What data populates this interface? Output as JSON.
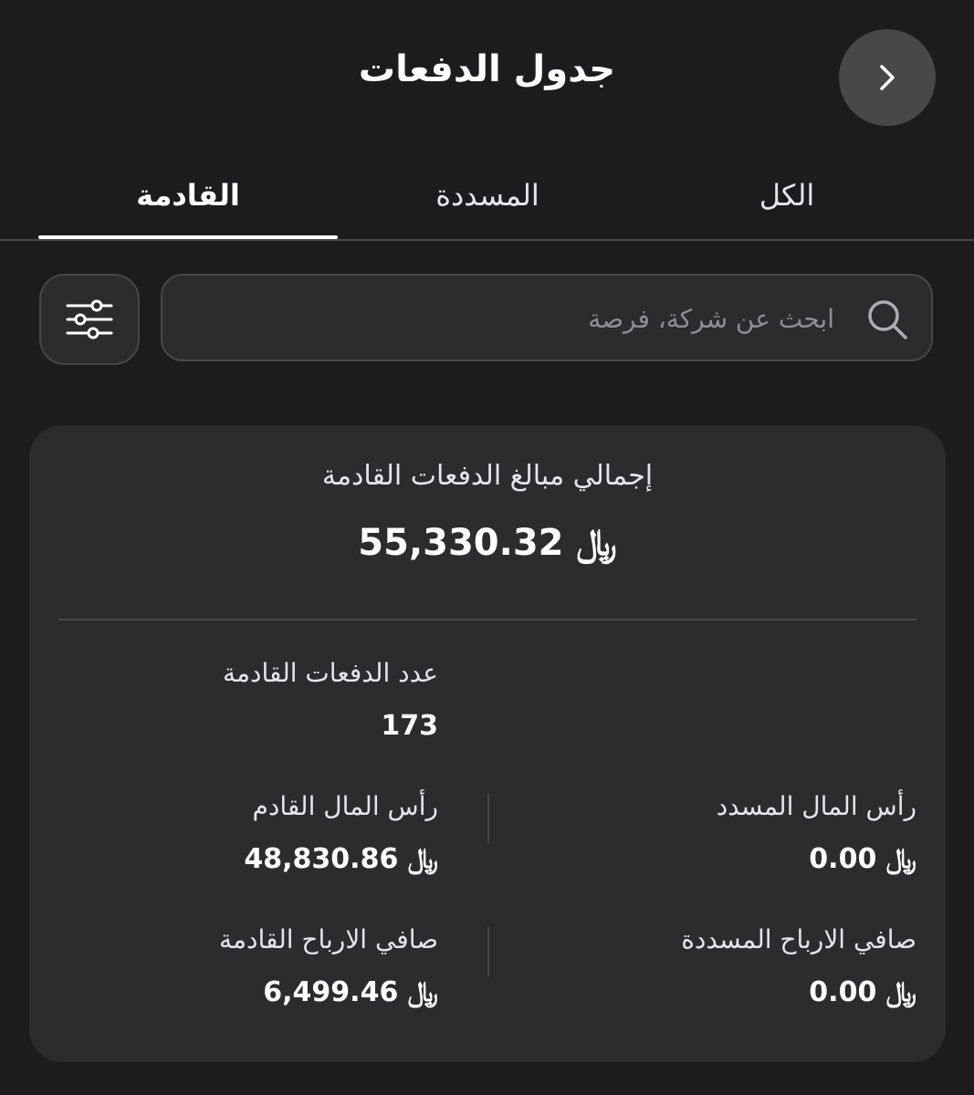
{
  "header": {
    "title": "جدول الدفعات"
  },
  "tabs": [
    {
      "label": "الكل",
      "active": false
    },
    {
      "label": "المسددة",
      "active": false
    },
    {
      "label": "القادمة",
      "active": true
    }
  ],
  "search": {
    "placeholder": "ابحث عن شركة، فرصة",
    "value": ""
  },
  "icons": {
    "back": "chevron-right-icon",
    "search": "search-icon",
    "filter": "sliders-icon"
  },
  "summary": {
    "total_label": "إجمالي مبالغ الدفعات القادمة",
    "total_value": "55,330.32",
    "count_label": "عدد الدفعات القادمة",
    "count_value": "173",
    "upcoming_capital_label": "رأس المال القادم",
    "upcoming_capital_value": "48,830.86",
    "paid_capital_label": "رأس المال المسدد",
    "paid_capital_value": "0.00",
    "upcoming_profit_label": "صافي الارباح القادمة",
    "upcoming_profit_value": "6,499.46",
    "paid_profit_label": "صافي الارباح المسددة",
    "paid_profit_value": "0.00",
    "currency_symbol": "﷼"
  },
  "colors": {
    "background": "#1c1c1e",
    "card": "#2c2c2e",
    "divider": "#48484a",
    "text": "#ffffff",
    "muted": "#8e8e93"
  }
}
